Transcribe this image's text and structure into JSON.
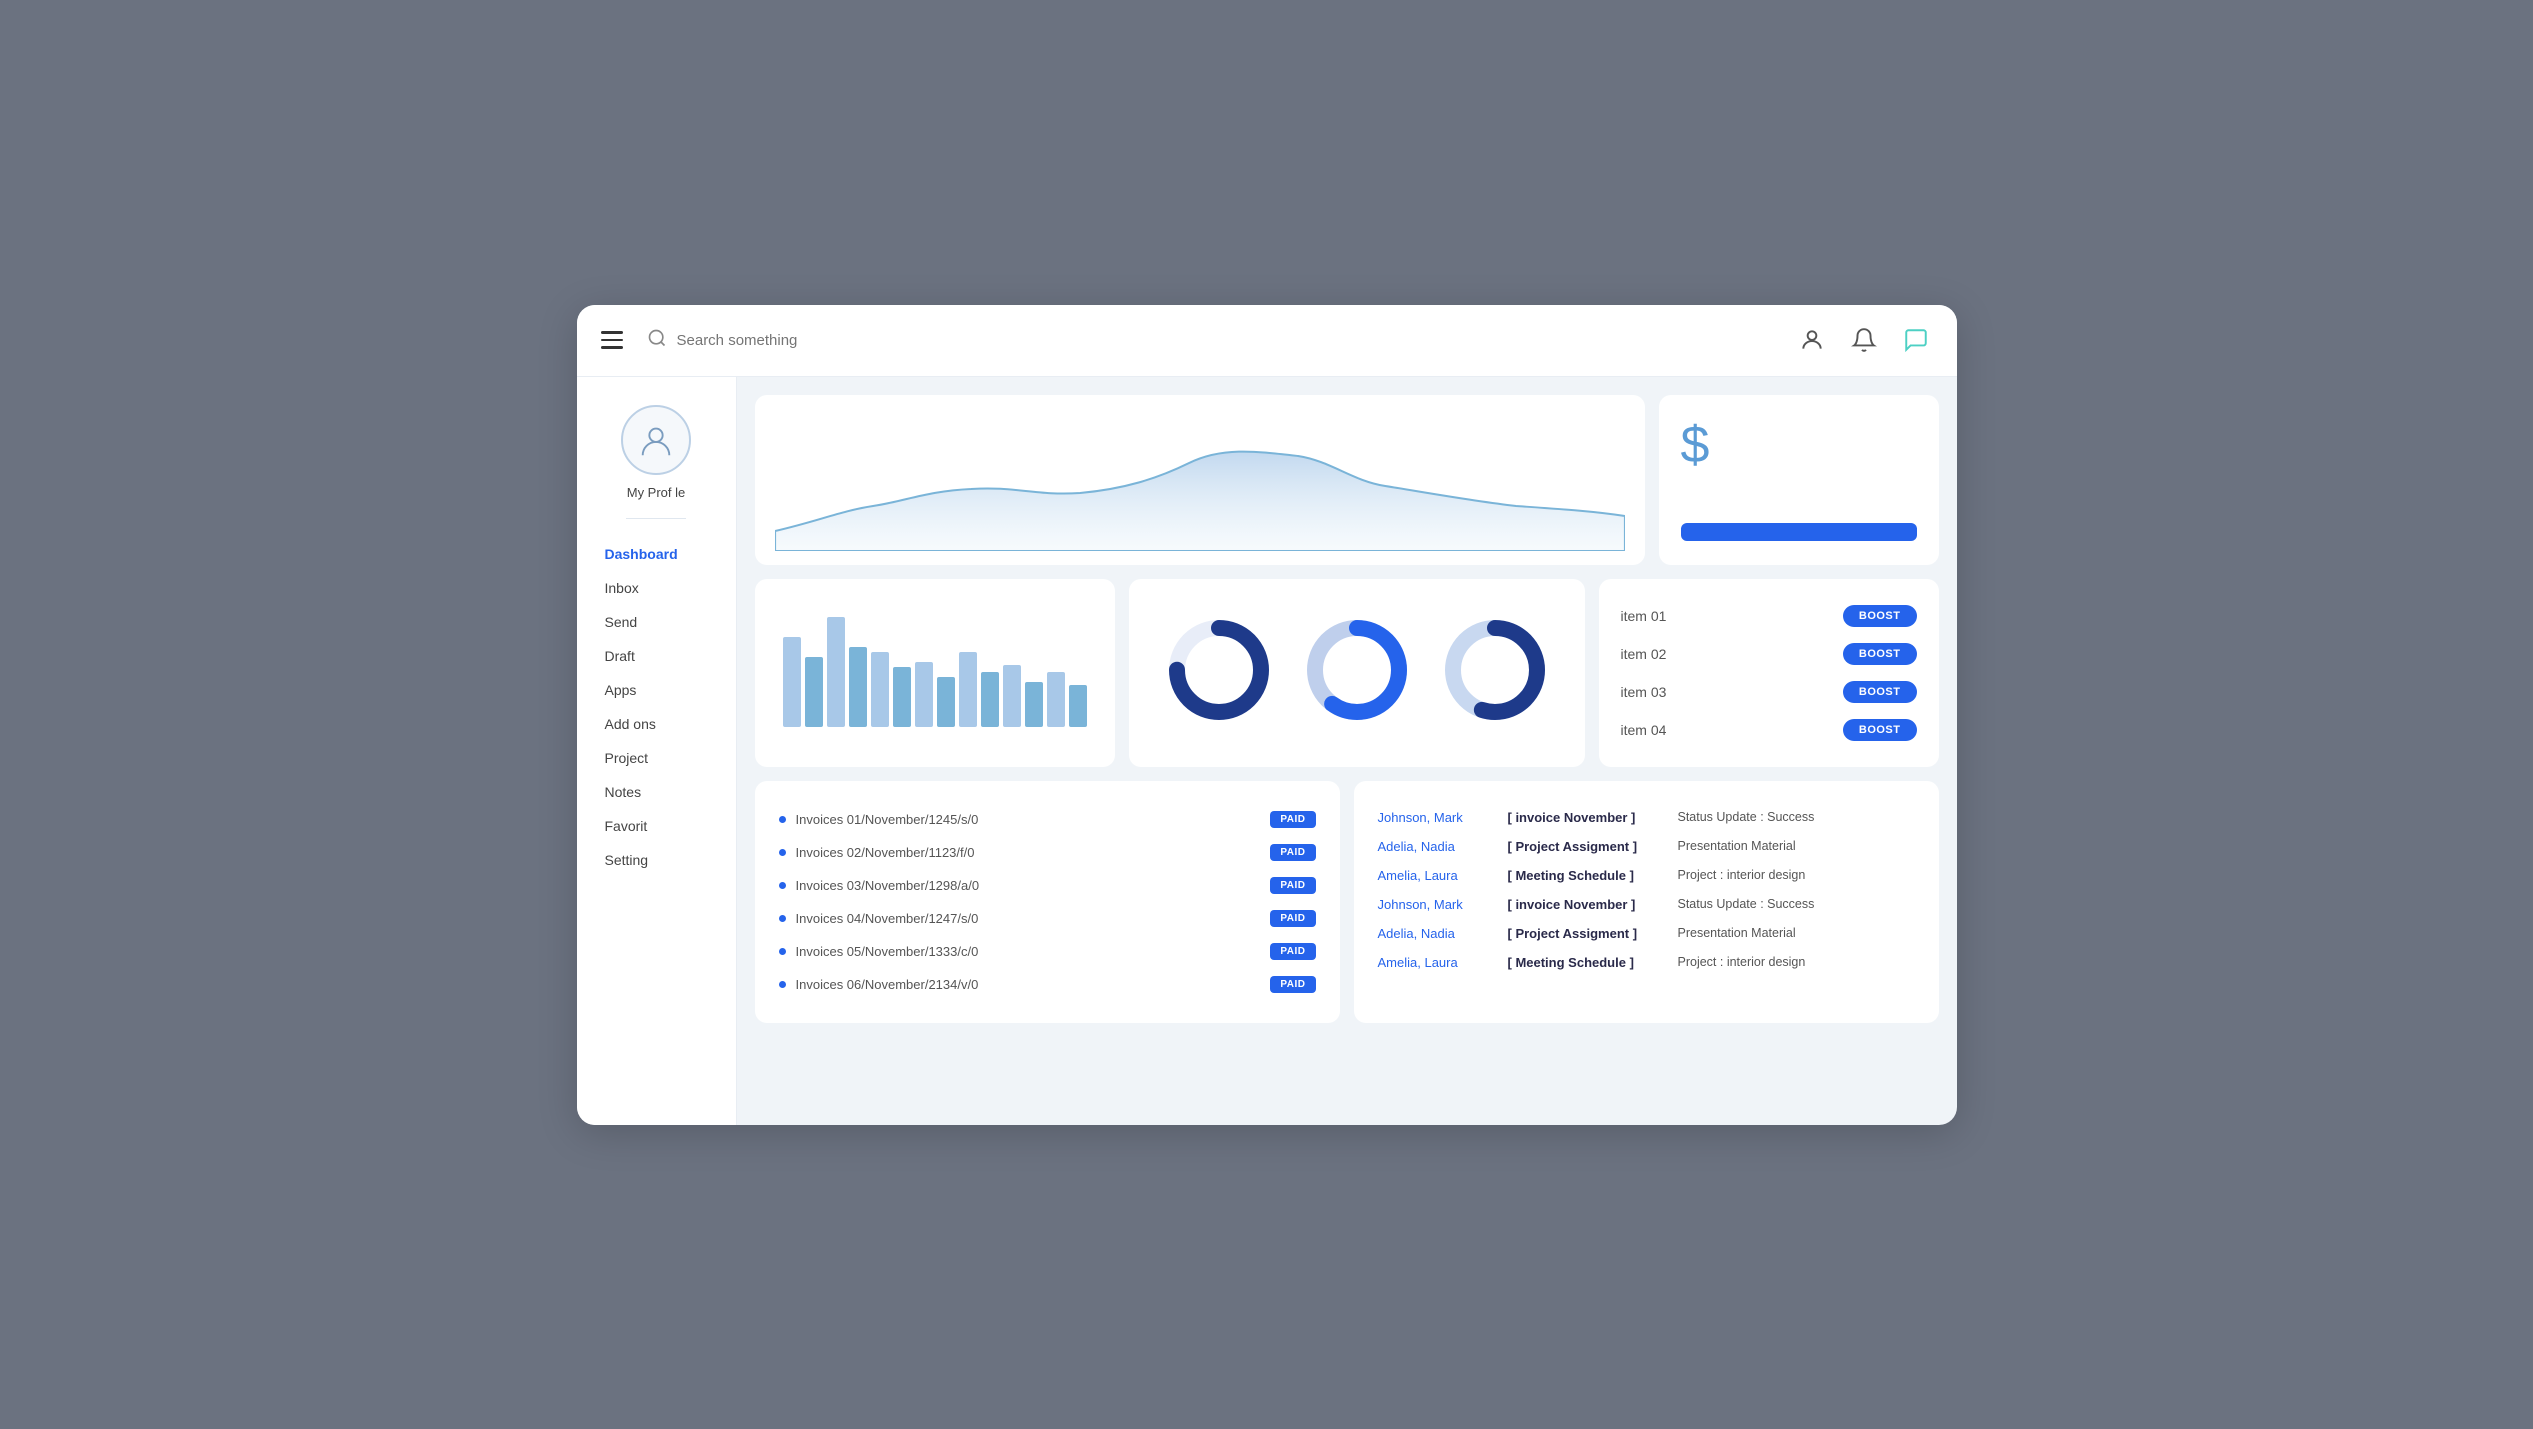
{
  "header": {
    "search_placeholder": "Search something",
    "hamburger_label": "menu"
  },
  "sidebar": {
    "profile_name": "My Prof le",
    "nav_items": [
      {
        "label": "Dashboard",
        "active": true
      },
      {
        "label": "Inbox",
        "active": false
      },
      {
        "label": "Send",
        "active": false
      },
      {
        "label": "Draft",
        "active": false
      },
      {
        "label": "Apps",
        "active": false
      },
      {
        "label": "Add ons",
        "active": false
      },
      {
        "label": "Project",
        "active": false
      },
      {
        "label": "Notes",
        "active": false
      },
      {
        "label": "Favorit",
        "active": false
      },
      {
        "label": "Setting",
        "active": false
      }
    ]
  },
  "stats_card": {
    "dollar_symbol": "$",
    "button_label": ""
  },
  "boost_items": [
    {
      "label": "item 01",
      "btn": "BOOST"
    },
    {
      "label": "item 02",
      "btn": "BOOST"
    },
    {
      "label": "item 03",
      "btn": "BOOST"
    },
    {
      "label": "item 04",
      "btn": "BOOST"
    }
  ],
  "invoices": [
    {
      "label": "Invoices 01/November/1245/s/0",
      "status": "PAID"
    },
    {
      "label": "Invoices 02/November/1123/f/0",
      "status": "PAID"
    },
    {
      "label": "Invoices 03/November/1298/a/0",
      "status": "PAID"
    },
    {
      "label": "Invoices 04/November/1247/s/0",
      "status": "PAID"
    },
    {
      "label": "Invoices 05/November/1333/c/0",
      "status": "PAID"
    },
    {
      "label": "Invoices 06/November/2134/v/0",
      "status": "PAID"
    }
  ],
  "activities": [
    {
      "name": "Johnson, Mark",
      "tag": "[ invoice November ]",
      "status": "Status Update : Success"
    },
    {
      "name": "Adelia, Nadia",
      "tag": "[ Project Assigment ]",
      "status": "Presentation Material"
    },
    {
      "name": "Amelia, Laura",
      "tag": "[ Meeting Schedule ]",
      "status": "Project : interior design"
    },
    {
      "name": "Johnson, Mark",
      "tag": "[ invoice November ]",
      "status": "Status Update : Success"
    },
    {
      "name": "Adelia, Nadia",
      "tag": "[ Project Assigment ]",
      "status": "Presentation Material"
    },
    {
      "name": "Amelia, Laura",
      "tag": "[ Meeting Schedule ]",
      "status": "Project : interior design"
    }
  ],
  "donuts": [
    {
      "pct": 75,
      "color": "#1e3a8a",
      "bg": "#e8edf8"
    },
    {
      "pct": 60,
      "color": "#2563eb",
      "bg": "#bfcfec"
    },
    {
      "pct": 55,
      "color": "#1e3a8a",
      "bg": "#c8d8f0"
    }
  ]
}
